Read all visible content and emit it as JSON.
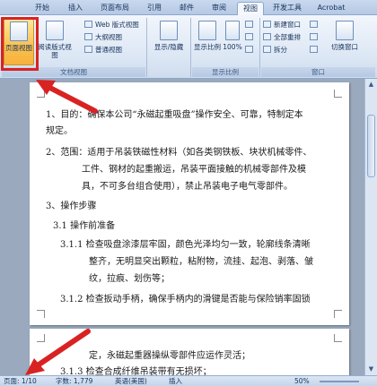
{
  "tabs": [
    "开始",
    "插入",
    "页面布局",
    "引用",
    "邮件",
    "审阅",
    "视图",
    "开发工具",
    "Acrobat"
  ],
  "active_tab": "视图",
  "ribbon": {
    "doc_views": {
      "page_view": "页面视图",
      "reading_view": "阅读版式视图",
      "web_view": "Web 版式视图",
      "outline_view": "大纲视图",
      "draft_view": "普通视图",
      "group_label": "文档视图"
    },
    "show_hide": {
      "label": "显示/隐藏"
    },
    "zoom": {
      "zoom_label": "显示比例",
      "hundred": "100%",
      "group_label": "显示比例"
    },
    "window": {
      "new_window": "新建窗口",
      "arrange_all": "全部重排",
      "split": "拆分",
      "switch_window": "切换窗口",
      "group_label": "窗口"
    }
  },
  "document": {
    "page1_lines": [
      "1、目的：确保本公司“永磁起重吸盘”操作安全、可靠，特制定本",
      "规定。",
      "2、范围：适用于吊装铁磁性材料（如各类钢铁板、块状机械零件、",
      "工件、钢材的起重搬运，吊装平面接触的机械零部件及模",
      "具，不可多台组合使用），禁止吊装电子电气零部件。",
      "3、操作步骤",
      "3.1 操作前准备",
      "3.1.1 检查吸盘涂漆层牢固，颜色光泽均匀一致，轮廓线条清晰",
      "整齐，无明显突出颗粒，粘附物，流挂、起泡、剥落、皱",
      "纹，拉痕、划伤等；",
      "3.1.2 检查扳动手柄，确保手柄内的滑键是否能与保险销率固锁"
    ],
    "page2_lines": [
      "定，永磁起重器操纵零部件应运作灵活；",
      "3.1.3 检查合成纤维吊装带有无损坏；"
    ]
  },
  "statusbar": {
    "page": "页面: 1/10",
    "words": "字数: 1,779",
    "language": "英语(美国)",
    "mode": "插入",
    "zoom": "50%"
  },
  "annotation_color": "#d92222"
}
